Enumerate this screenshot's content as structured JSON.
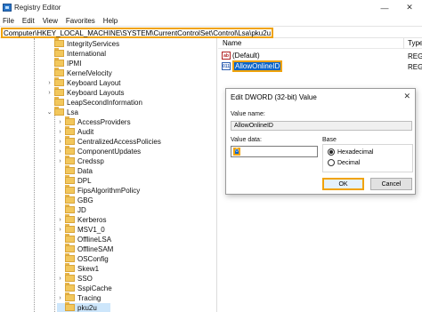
{
  "window": {
    "title": "Registry Editor",
    "minimize": "—",
    "close": "✕"
  },
  "menu": [
    "File",
    "Edit",
    "View",
    "Favorites",
    "Help"
  ],
  "address": "Computer\\HKEY_LOCAL_MACHINE\\SYSTEM\\CurrentControlSet\\Control\\Lsa\\pku2u",
  "tree": {
    "items": [
      {
        "label": "IntegrityServices",
        "chev": ""
      },
      {
        "label": "International",
        "chev": ""
      },
      {
        "label": "IPMI",
        "chev": ""
      },
      {
        "label": "KernelVelocity",
        "chev": ""
      },
      {
        "label": "Keyboard Layout",
        "chev": "›"
      },
      {
        "label": "Keyboard Layouts",
        "chev": "›"
      },
      {
        "label": "LeapSecondInformation",
        "chev": ""
      },
      {
        "label": "Lsa",
        "chev": "⌄"
      },
      {
        "label": "AccessProviders",
        "chev": "›"
      },
      {
        "label": "Audit",
        "chev": "›"
      },
      {
        "label": "CentralizedAccessPolicies",
        "chev": "›"
      },
      {
        "label": "ComponentUpdates",
        "chev": "›"
      },
      {
        "label": "Credssp",
        "chev": "›"
      },
      {
        "label": "Data",
        "chev": ""
      },
      {
        "label": "DPL",
        "chev": ""
      },
      {
        "label": "FipsAlgorithmPolicy",
        "chev": ""
      },
      {
        "label": "GBG",
        "chev": ""
      },
      {
        "label": "JD",
        "chev": ""
      },
      {
        "label": "Kerberos",
        "chev": "›"
      },
      {
        "label": "MSV1_0",
        "chev": "›"
      },
      {
        "label": "OfflineLSA",
        "chev": ""
      },
      {
        "label": "OfflineSAM",
        "chev": ""
      },
      {
        "label": "OSConfig",
        "chev": ""
      },
      {
        "label": "Skew1",
        "chev": ""
      },
      {
        "label": "SSO",
        "chev": "›"
      },
      {
        "label": "SspiCache",
        "chev": ""
      },
      {
        "label": "Tracing",
        "chev": "›"
      },
      {
        "label": "pku2u",
        "chev": ""
      }
    ]
  },
  "list": {
    "col_name": "Name",
    "col_type": "Type",
    "rows": [
      {
        "icon": "ab",
        "name": "(Default)",
        "type": "REG"
      },
      {
        "icon": "011",
        "name": "AllowOnlineID",
        "type": "REG"
      }
    ]
  },
  "dialog": {
    "title": "Edit DWORD (32-bit) Value",
    "close": "✕",
    "value_name_label": "Value name:",
    "value_name": "AllowOnlineID",
    "value_data_label": "Value data:",
    "value_data": "0",
    "base_label": "Base",
    "hex": "Hexadecimal",
    "dec": "Decimal",
    "ok": "OK",
    "cancel": "Cancel"
  },
  "colors": {
    "highlight": "#f0a30a",
    "selection": "#0a64c8"
  }
}
